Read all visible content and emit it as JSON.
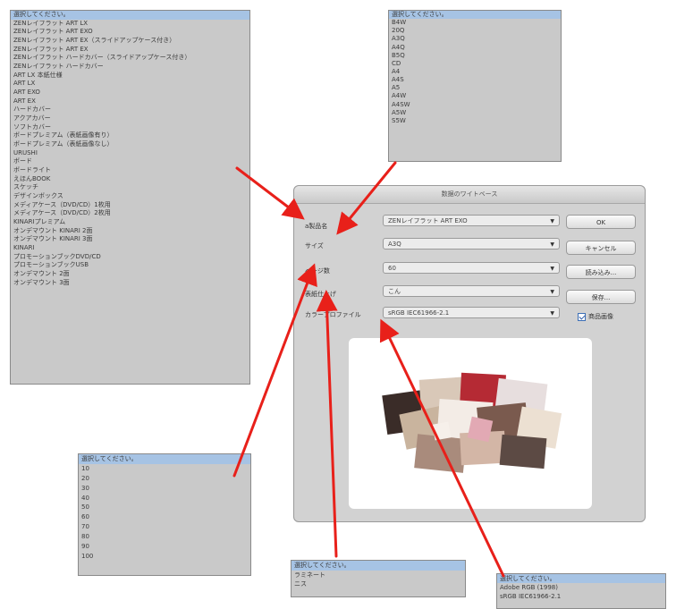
{
  "dialog": {
    "title": "数据のワイトベース",
    "labels": {
      "product": "a製品名",
      "size": "サイズ",
      "pages": "ページ数",
      "finish": "表紙仕上げ",
      "profile": "カラープロファイル"
    },
    "selects": {
      "product": "ZENレイフラット ART EXO",
      "size": "A3Q",
      "pages": "60",
      "finish": "こん",
      "profile": "sRGB IEC61966-2.1"
    },
    "buttons": {
      "ok": "OK",
      "cancel": "キャンセル",
      "load": "読み込み...",
      "save": "保存..."
    },
    "checkbox": {
      "label": "商品画像",
      "checked": true
    }
  },
  "product_list": {
    "items": [
      "選択してください。",
      "ZENレイフラット ART LX",
      "ZENレイフラット ART EXO",
      "ZENレイフラット ART EX（スライドアップケース付き）",
      "ZENレイフラット ART EX",
      "ZENレイフラット ハードカバー（スライドアップケース付き）",
      "ZENレイフラット ハードカバー",
      "ART LX 本紙仕様",
      "ART LX",
      "ART EXO",
      "ART EX",
      "ハードカバー",
      "アクアカバー",
      "ソフトカバー",
      "ボードプレミアム（表紙画像有り）",
      "ボードプレミアム（表紙画像なし）",
      "URUSHI",
      "ボード",
      "ボードライト",
      "えほんBOOK",
      "スケッチ",
      "デザインボックス",
      "メディアケース（DVD/CD）1枚用",
      "メディアケース（DVD/CD）2枚用",
      "KINARIプレミアム",
      "オンデマウント KINARI 2面",
      "オンデマウント KINARI 3面",
      "KINARI",
      "プロモーションブックDVD/CD",
      "プロモーションブックUSB",
      "オンデマウント 2面",
      "オンデマウント 3面"
    ]
  },
  "size_list": {
    "items": [
      "選択してください。",
      "B4W",
      "20Q",
      "A3Q",
      "A4Q",
      "B5Q",
      "CD",
      "A4",
      "A4S",
      "A5",
      "A4W",
      "A4SW",
      "A5W",
      "S5W"
    ]
  },
  "pages_list": {
    "items": [
      "選択してください。",
      "10",
      "20",
      "30",
      "40",
      "50",
      "60",
      "70",
      "80",
      "90",
      "100"
    ]
  },
  "finish_list": {
    "items": [
      "選択してください。",
      "ラミネート",
      "ニス"
    ]
  },
  "profile_list": {
    "items": [
      "選択してください。",
      "Adobe RGB (1998)",
      "sRGB IEC61966-2.1"
    ]
  },
  "colors": {
    "arrow": "#e8201a",
    "list_bg": "#c9c9c9",
    "selected_row": "#a6c3e4",
    "dialog_bg": "#d2d2d2"
  }
}
